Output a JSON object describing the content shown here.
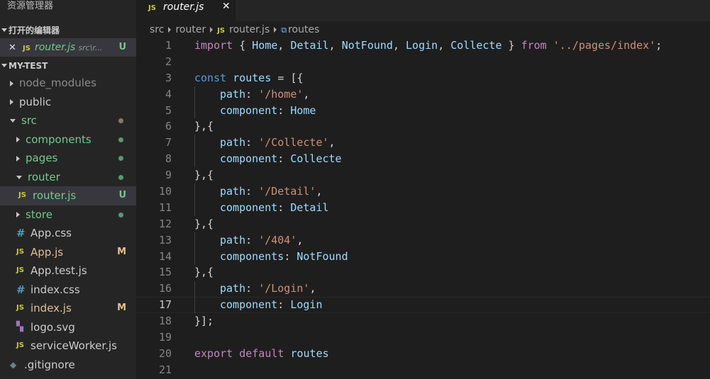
{
  "sidebar": {
    "title": "资源管理器",
    "open_editors_header": "打开的编辑器",
    "open_editor": {
      "close": "✕",
      "icon": "JS",
      "name": "router.js",
      "path": "src\\r...",
      "status": "U"
    },
    "project_header": "MY-TEST",
    "tree": [
      {
        "label": "node_modules",
        "kind": "folder",
        "expanded": false,
        "indent": 0,
        "color": "gray"
      },
      {
        "label": "public",
        "kind": "folder",
        "expanded": false,
        "indent": 0,
        "color": "plain"
      },
      {
        "label": "src",
        "kind": "folder",
        "expanded": true,
        "indent": 0,
        "color": "green",
        "dot": "brown"
      },
      {
        "label": "components",
        "kind": "folder",
        "expanded": false,
        "indent": 1,
        "color": "green",
        "dot": "green"
      },
      {
        "label": "pages",
        "kind": "folder",
        "expanded": false,
        "indent": 1,
        "color": "green",
        "dot": "green"
      },
      {
        "label": "router",
        "kind": "folder",
        "expanded": true,
        "indent": 1,
        "color": "green",
        "dot": "green"
      },
      {
        "label": "router.js",
        "kind": "js",
        "indent": 2,
        "color": "green",
        "badge": "U",
        "active": true
      },
      {
        "label": "store",
        "kind": "folder",
        "expanded": false,
        "indent": 1,
        "color": "green",
        "dot": "green"
      },
      {
        "label": "App.css",
        "kind": "css",
        "indent": 1,
        "color": "plain"
      },
      {
        "label": "App.js",
        "kind": "js",
        "indent": 1,
        "color": "yellow",
        "badge": "M"
      },
      {
        "label": "App.test.js",
        "kind": "js",
        "indent": 1,
        "color": "plain"
      },
      {
        "label": "index.css",
        "kind": "css",
        "indent": 1,
        "color": "plain"
      },
      {
        "label": "index.js",
        "kind": "js",
        "indent": 1,
        "color": "yellow",
        "badge": "M"
      },
      {
        "label": "logo.svg",
        "kind": "svg",
        "indent": 1,
        "color": "plain"
      },
      {
        "label": "serviceWorker.js",
        "kind": "js",
        "indent": 1,
        "color": "plain"
      },
      {
        "label": ".gitignore",
        "kind": "git",
        "indent": 0,
        "color": "plain"
      }
    ]
  },
  "editor": {
    "tab": {
      "icon": "JS",
      "name": "router.js",
      "close": "✕"
    },
    "breadcrumb": {
      "parts": [
        "src",
        "router"
      ],
      "file_icon": "JS",
      "file": "router.js",
      "symbol_icon": "⧉",
      "symbol": "routes"
    },
    "current_line": 17,
    "lines": [
      [
        [
          "kwc",
          "import"
        ],
        [
          "punc",
          " { "
        ],
        [
          "var",
          "Home"
        ],
        [
          "punc",
          ", "
        ],
        [
          "var",
          "Detail"
        ],
        [
          "punc",
          ", "
        ],
        [
          "var",
          "NotFound"
        ],
        [
          "punc",
          ", "
        ],
        [
          "var",
          "Login"
        ],
        [
          "punc",
          ", "
        ],
        [
          "var",
          "Collecte"
        ],
        [
          "punc",
          " } "
        ],
        [
          "kwc",
          "from"
        ],
        [
          "punc",
          " "
        ],
        [
          "str",
          "'../pages/index'"
        ],
        [
          "punc",
          ";"
        ]
      ],
      [],
      [
        [
          "kw",
          "const"
        ],
        [
          "punc",
          " "
        ],
        [
          "var",
          "routes"
        ],
        [
          "punc",
          " = [{"
        ]
      ],
      [
        [
          "ind",
          ""
        ],
        [
          "var",
          "path"
        ],
        [
          "punc",
          ": "
        ],
        [
          "str",
          "'/home'"
        ],
        [
          "punc",
          ","
        ]
      ],
      [
        [
          "ind",
          ""
        ],
        [
          "var",
          "component"
        ],
        [
          "punc",
          ": "
        ],
        [
          "var",
          "Home"
        ]
      ],
      [
        [
          "punc",
          "},{"
        ]
      ],
      [
        [
          "ind",
          ""
        ],
        [
          "var",
          "path"
        ],
        [
          "punc",
          ": "
        ],
        [
          "str",
          "'/Collecte'"
        ],
        [
          "punc",
          ","
        ]
      ],
      [
        [
          "ind",
          ""
        ],
        [
          "var",
          "component"
        ],
        [
          "punc",
          ": "
        ],
        [
          "var",
          "Collecte"
        ]
      ],
      [
        [
          "punc",
          "},{"
        ]
      ],
      [
        [
          "ind",
          ""
        ],
        [
          "var",
          "path"
        ],
        [
          "punc",
          ": "
        ],
        [
          "str",
          "'/Detail'"
        ],
        [
          "punc",
          ","
        ]
      ],
      [
        [
          "ind",
          ""
        ],
        [
          "var",
          "component"
        ],
        [
          "punc",
          ": "
        ],
        [
          "var",
          "Detail"
        ]
      ],
      [
        [
          "punc",
          "},{"
        ]
      ],
      [
        [
          "ind",
          ""
        ],
        [
          "var",
          "path"
        ],
        [
          "punc",
          ": "
        ],
        [
          "str",
          "'/404'"
        ],
        [
          "punc",
          ","
        ]
      ],
      [
        [
          "ind",
          ""
        ],
        [
          "var",
          "components"
        ],
        [
          "punc",
          ": "
        ],
        [
          "var",
          "NotFound"
        ]
      ],
      [
        [
          "punc",
          "},{"
        ]
      ],
      [
        [
          "ind",
          ""
        ],
        [
          "var",
          "path"
        ],
        [
          "punc",
          ": "
        ],
        [
          "str",
          "'/Login'"
        ],
        [
          "punc",
          ","
        ]
      ],
      [
        [
          "ind",
          ""
        ],
        [
          "var",
          "component"
        ],
        [
          "punc",
          ": "
        ],
        [
          "var",
          "Login"
        ]
      ],
      [
        [
          "punc",
          "}];"
        ]
      ],
      [],
      [
        [
          "kwc",
          "export"
        ],
        [
          "punc",
          " "
        ],
        [
          "kwc",
          "default"
        ],
        [
          "punc",
          " "
        ],
        [
          "var",
          "routes"
        ]
      ],
      []
    ]
  }
}
